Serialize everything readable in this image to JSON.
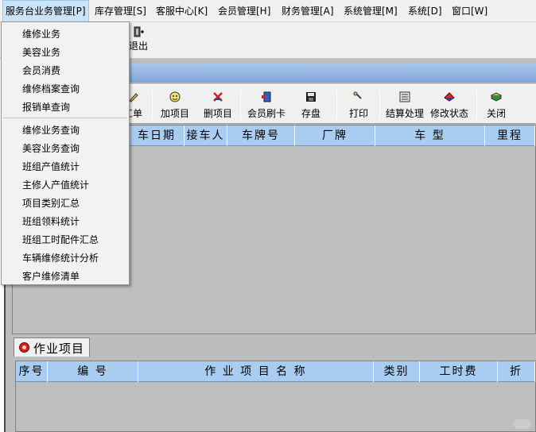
{
  "menubar": {
    "items": [
      {
        "label": "服务台业务管理[P]",
        "active": true
      },
      {
        "label": "库存管理[S]"
      },
      {
        "label": "客服中心[K]"
      },
      {
        "label": "会员管理[H]"
      },
      {
        "label": "财务管理[A]"
      },
      {
        "label": "系统管理[M]"
      },
      {
        "label": "系统[D]"
      },
      {
        "label": "窗口[W]"
      }
    ]
  },
  "top_toolbar": {
    "exit_label": "退出"
  },
  "dropdown": {
    "items": [
      "维修业务",
      "美容业务",
      "会员消费",
      "维修档案查询",
      "报销单查询",
      "维修业务查询",
      "美容业务查询",
      "班组产值统计",
      "主修人产值统计",
      "项目类别汇总",
      "班组领料统计",
      "班组工时配件汇总",
      "车辆维修统计分析",
      "客户维修清单"
    ]
  },
  "child_toolbar": {
    "buttons": [
      "工单",
      "加项目",
      "删项目",
      "会员刷卡",
      "存盘",
      "打印",
      "结算处理",
      "修改状态",
      "关闭"
    ]
  },
  "main_grid": {
    "columns": [
      "车日期",
      "接车人",
      "车牌号",
      "厂牌",
      "车 型",
      "里程"
    ]
  },
  "tab": {
    "label": "作业项目"
  },
  "detail_grid": {
    "columns": [
      "序号",
      "编 号",
      "作 业 项 目 名 称",
      "类别",
      "工时费",
      "折"
    ]
  },
  "colors": {
    "menu_active": "#cce4f7",
    "grid_header": "#a8cdf0",
    "title_gradient": "#7ea6d8"
  }
}
